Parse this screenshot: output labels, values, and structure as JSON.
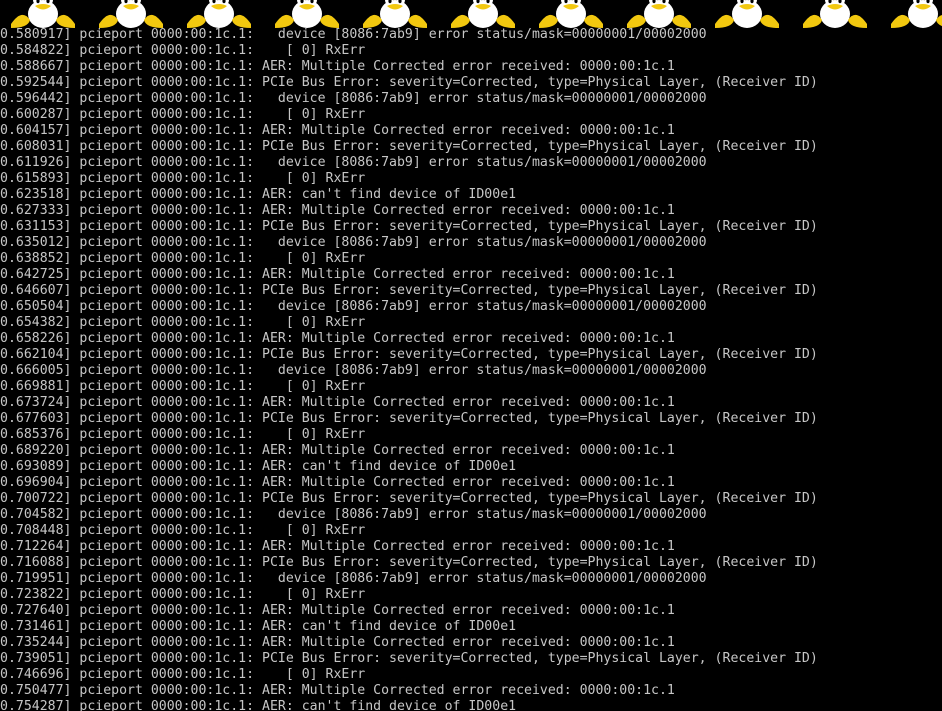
{
  "boot_logo": {
    "icon": "tux-penguin-icon",
    "count": 11,
    "colors": {
      "body": "#000000",
      "belly": "#ffffff",
      "beak_feet": "#f2c80f"
    }
  },
  "console": {
    "lines": [
      "0.580917] pcieport 0000:00:1c.1:   device [8086:7ab9] error status/mask=00000001/00002000",
      "0.584822] pcieport 0000:00:1c.1:    [ 0] RxErr",
      "0.588667] pcieport 0000:00:1c.1: AER: Multiple Corrected error received: 0000:00:1c.1",
      "0.592544] pcieport 0000:00:1c.1: PCIe Bus Error: severity=Corrected, type=Physical Layer, (Receiver ID)",
      "0.596442] pcieport 0000:00:1c.1:   device [8086:7ab9] error status/mask=00000001/00002000",
      "0.600287] pcieport 0000:00:1c.1:    [ 0] RxErr",
      "0.604157] pcieport 0000:00:1c.1: AER: Multiple Corrected error received: 0000:00:1c.1",
      "0.608031] pcieport 0000:00:1c.1: PCIe Bus Error: severity=Corrected, type=Physical Layer, (Receiver ID)",
      "0.611926] pcieport 0000:00:1c.1:   device [8086:7ab9] error status/mask=00000001/00002000",
      "0.615893] pcieport 0000:00:1c.1:    [ 0] RxErr",
      "0.623518] pcieport 0000:00:1c.1: AER: can't find device of ID00e1",
      "0.627333] pcieport 0000:00:1c.1: AER: Multiple Corrected error received: 0000:00:1c.1",
      "0.631153] pcieport 0000:00:1c.1: PCIe Bus Error: severity=Corrected, type=Physical Layer, (Receiver ID)",
      "0.635012] pcieport 0000:00:1c.1:   device [8086:7ab9] error status/mask=00000001/00002000",
      "0.638852] pcieport 0000:00:1c.1:    [ 0] RxErr",
      "0.642725] pcieport 0000:00:1c.1: AER: Multiple Corrected error received: 0000:00:1c.1",
      "0.646607] pcieport 0000:00:1c.1: PCIe Bus Error: severity=Corrected, type=Physical Layer, (Receiver ID)",
      "0.650504] pcieport 0000:00:1c.1:   device [8086:7ab9] error status/mask=00000001/00002000",
      "0.654382] pcieport 0000:00:1c.1:    [ 0] RxErr",
      "0.658226] pcieport 0000:00:1c.1: AER: Multiple Corrected error received: 0000:00:1c.1",
      "0.662104] pcieport 0000:00:1c.1: PCIe Bus Error: severity=Corrected, type=Physical Layer, (Receiver ID)",
      "0.666005] pcieport 0000:00:1c.1:   device [8086:7ab9] error status/mask=00000001/00002000",
      "0.669881] pcieport 0000:00:1c.1:    [ 0] RxErr",
      "0.673724] pcieport 0000:00:1c.1: AER: Multiple Corrected error received: 0000:00:1c.1",
      "0.677603] pcieport 0000:00:1c.1: PCIe Bus Error: severity=Corrected, type=Physical Layer, (Receiver ID)",
      "0.685376] pcieport 0000:00:1c.1:    [ 0] RxErr",
      "0.689220] pcieport 0000:00:1c.1: AER: Multiple Corrected error received: 0000:00:1c.1",
      "0.693089] pcieport 0000:00:1c.1: AER: can't find device of ID00e1",
      "0.696904] pcieport 0000:00:1c.1: AER: Multiple Corrected error received: 0000:00:1c.1",
      "0.700722] pcieport 0000:00:1c.1: PCIe Bus Error: severity=Corrected, type=Physical Layer, (Receiver ID)",
      "0.704582] pcieport 0000:00:1c.1:   device [8086:7ab9] error status/mask=00000001/00002000",
      "0.708448] pcieport 0000:00:1c.1:    [ 0] RxErr",
      "0.712264] pcieport 0000:00:1c.1: AER: Multiple Corrected error received: 0000:00:1c.1",
      "0.716088] pcieport 0000:00:1c.1: PCIe Bus Error: severity=Corrected, type=Physical Layer, (Receiver ID)",
      "0.719951] pcieport 0000:00:1c.1:   device [8086:7ab9] error status/mask=00000001/00002000",
      "0.723822] pcieport 0000:00:1c.1:    [ 0] RxErr",
      "0.727640] pcieport 0000:00:1c.1: AER: Multiple Corrected error received: 0000:00:1c.1",
      "0.731461] pcieport 0000:00:1c.1: AER: can't find device of ID00e1",
      "0.735244] pcieport 0000:00:1c.1: AER: Multiple Corrected error received: 0000:00:1c.1",
      "0.739051] pcieport 0000:00:1c.1: PCIe Bus Error: severity=Corrected, type=Physical Layer, (Receiver ID)",
      "0.746696] pcieport 0000:00:1c.1:    [ 0] RxErr",
      "0.750477] pcieport 0000:00:1c.1: AER: Multiple Corrected error received: 0000:00:1c.1",
      "0.754287] pcieport 0000:00:1c.1: AER: can't find device of ID00e1"
    ]
  }
}
